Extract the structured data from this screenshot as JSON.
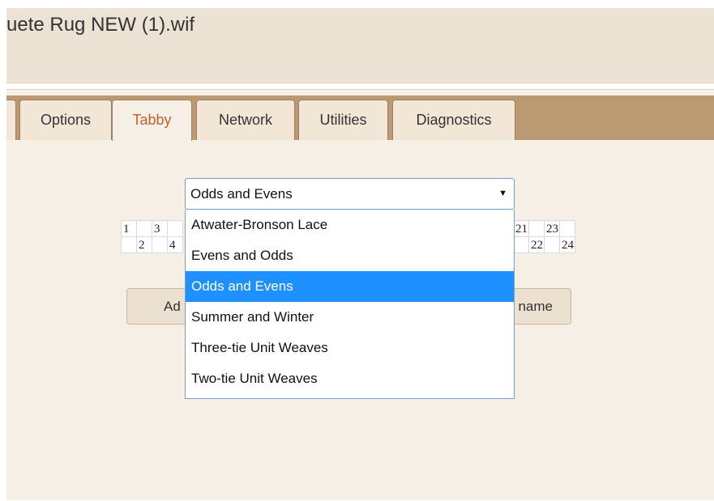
{
  "header": {
    "title": "uete Rug NEW (1).wif"
  },
  "tabs": [
    {
      "label": "Options",
      "active": false
    },
    {
      "label": "Tabby",
      "active": true
    },
    {
      "label": "Network",
      "active": false
    },
    {
      "label": "Utilities",
      "active": false
    },
    {
      "label": "Diagnostics",
      "active": false
    }
  ],
  "tabby": {
    "select": {
      "value": "Odds and Evens",
      "options": [
        "Atwater-Bronson Lace",
        "Evens and Odds",
        "Odds and Evens",
        "Summer and Winter",
        "Three-tie Unit Weaves",
        "Two-tie Unit Weaves"
      ],
      "selected_index": 2
    },
    "grid_left": {
      "top": [
        "1",
        "",
        "3",
        ""
      ],
      "bottom": [
        "",
        "2",
        "",
        "4"
      ]
    },
    "grid_right": {
      "top": [
        "21",
        "",
        "23",
        ""
      ],
      "bottom": [
        "",
        "22",
        "",
        "24"
      ]
    },
    "buttons": {
      "left_partial": "Ad",
      "right_partial": "name"
    }
  },
  "colors": {
    "tab_bar": "#bb9a73",
    "active_tab_text": "#c0622b",
    "selected_option": "#1e90ff"
  }
}
